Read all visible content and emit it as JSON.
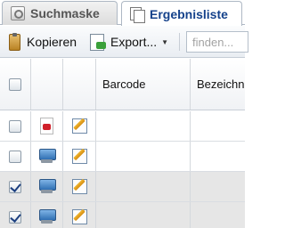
{
  "tabs": [
    {
      "label": "Suchmaske",
      "icon": "magnifier-icon",
      "active": false
    },
    {
      "label": "Ergebnisliste",
      "icon": "pages-icon",
      "active": true
    }
  ],
  "toolbar": {
    "copy_label": "Kopieren",
    "export_label": "Export...",
    "search_placeholder": "finden..."
  },
  "grid": {
    "columns": [
      "",
      "",
      "",
      "Barcode",
      "Bezeichnung"
    ],
    "rows": [
      {
        "checked": false,
        "type_icon": "pdf-icon",
        "barcode": "",
        "bezeichnung": ""
      },
      {
        "checked": false,
        "type_icon": "monitor-icon",
        "barcode": "",
        "bezeichnung": ""
      },
      {
        "checked": true,
        "type_icon": "monitor-icon",
        "barcode": "",
        "bezeichnung": ""
      },
      {
        "checked": true,
        "type_icon": "monitor-icon",
        "barcode": "",
        "bezeichnung": ""
      }
    ]
  },
  "colors": {
    "active_tab_text": "#15428b",
    "selected_row": "#e6e6e6",
    "border": "#aeb8c4"
  }
}
